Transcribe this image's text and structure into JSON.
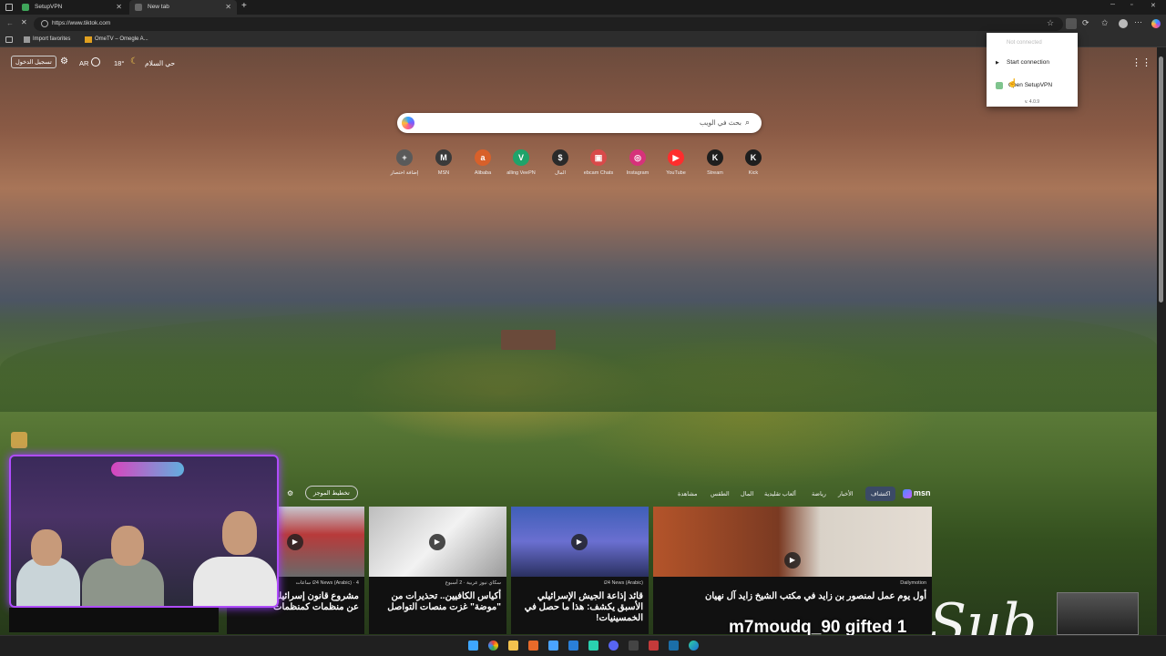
{
  "browser": {
    "tabs": [
      {
        "label": "SetupVPN",
        "active": false
      },
      {
        "label": "New tab",
        "active": true
      }
    ],
    "url": "https://www.tiktok.com",
    "bookmarks": [
      {
        "label": "Import favorites"
      },
      {
        "label": "OmeTV – Omegle A..."
      }
    ]
  },
  "newtab": {
    "signin_label": "تسجيل الدخول",
    "lang": "AR",
    "weather_temp": "18°",
    "weather_location": "حي السلام",
    "search_placeholder": "بحث في الويب",
    "quick_links": [
      {
        "label": "إضافة اختصار",
        "icon": "plus-icon",
        "color": "#5a5a5a",
        "glyph": "+"
      },
      {
        "label": "MSN",
        "icon": "msn-icon",
        "color": "#3a3a3a",
        "glyph": "M"
      },
      {
        "label": "Alibaba",
        "icon": "alibaba-icon",
        "color": "#d8602a",
        "glyph": "a"
      },
      {
        "label": "alling VeePN",
        "icon": "veepn-icon",
        "color": "#1fa36a",
        "glyph": "V"
      },
      {
        "label": "المال",
        "icon": "money-icon",
        "color": "#2a2a2a",
        "glyph": "$"
      },
      {
        "label": "ebcam Chats",
        "icon": "webcam-chats-icon",
        "color": "#d84a4a",
        "glyph": "▣"
      },
      {
        "label": "Instagram",
        "icon": "instagram-icon",
        "color": "#d6327a",
        "glyph": "◎"
      },
      {
        "label": "YouTube",
        "icon": "youtube-icon",
        "color": "#ff2d2d",
        "glyph": "▶"
      },
      {
        "label": "Stream",
        "icon": "kick-stream-icon",
        "color": "#1e1e1e",
        "glyph": "K"
      },
      {
        "label": "Kick",
        "icon": "kick-icon",
        "color": "#1e1e1e",
        "glyph": "K"
      }
    ]
  },
  "vpn_popup": {
    "status": "Not connected",
    "start": "Start connection",
    "open": "Open SetupVPN",
    "version": "v. 4.0.9"
  },
  "feed": {
    "brand": "msn",
    "nav": [
      "اكتشاف",
      "الأخبار",
      "رياضة",
      "ألعاب تقليدية",
      "المال",
      "الطقس",
      "مشاهدة"
    ],
    "personalize": "تخطيط الموجز",
    "cards": [
      {
        "source": "Dailymotion",
        "title": "أول يوم عمل لمنصور بن زايد في مكتب الشيخ زايد آل نهيان"
      },
      {
        "source": "i24 News (Arabic)",
        "title": "قائد إذاعة الجيش الإسرائيلي الأسبق يكشف: هذا ما حصل في الخمسينيات!"
      },
      {
        "source": "سكاي نيوز عربية · 2 أسبوع",
        "title": "أكياس الكافيين.. تحذيرات من \"موضة\" غزت منصات التواصل"
      },
      {
        "source": "i24 News (Arabic) · 4 ساعات",
        "title": "مشروع قانون إسرائيلي الإعلان عن منظمات كمنظمات"
      }
    ]
  },
  "overlay": {
    "gifted_text": "m7moudq_90 gifted 1",
    "sub_text": "Sub"
  }
}
